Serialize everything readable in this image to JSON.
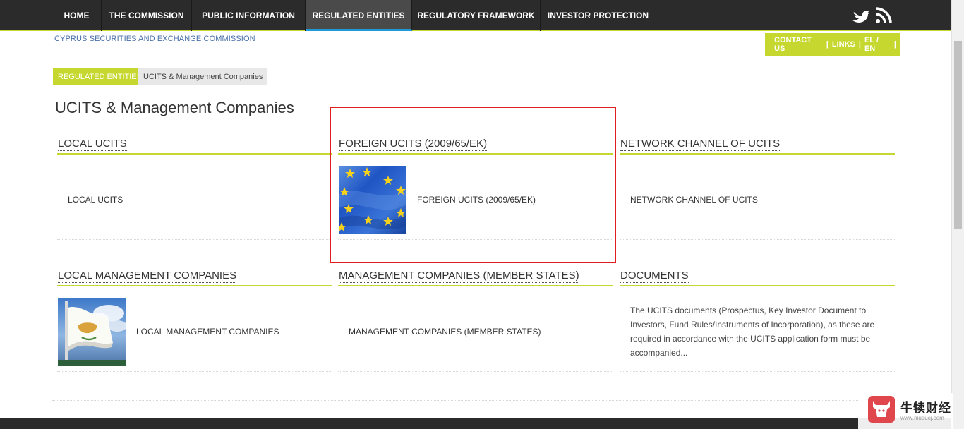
{
  "nav": {
    "items": [
      {
        "label": "HOME"
      },
      {
        "label": "THE COMMISSION"
      },
      {
        "label": "PUBLIC INFORMATION"
      },
      {
        "label": "REGULATED ENTITIES"
      },
      {
        "label": "REGULATORY FRAMEWORK"
      },
      {
        "label": "INVESTOR PROTECTION"
      }
    ],
    "active": "REGULATED ENTITIES",
    "icons": [
      "twitter-icon",
      "rss-icon"
    ]
  },
  "logo_text": "CYPRUS SECURITIES AND EXCHANGE COMMISSION",
  "contact": {
    "contact_us": "CONTACT US",
    "sep": "|",
    "links": "LINKS",
    "lang": "EL / EN"
  },
  "breadcrumb": {
    "parent": "REGULATED ENTITIES",
    "current": "UCITS & Management Companies"
  },
  "page_title": "UCITS & Management Companies",
  "sections": [
    {
      "title": "LOCAL UCITS",
      "link": "LOCAL UCITS"
    },
    {
      "title": "FOREIGN UCITS (2009/65/EK)",
      "link": "FOREIGN UCITS (2009/65/EK)",
      "image": "eu-flag-image"
    },
    {
      "title": "NETWORK CHANNEL OF UCITS",
      "link": "NETWORK CHANNEL OF UCITS"
    },
    {
      "title": "LOCAL MANAGEMENT COMPANIES",
      "link": "LOCAL MANAGEMENT COMPANIES",
      "image": "cyprus-flag-image"
    },
    {
      "title": "MANAGEMENT COMPANIES (MEMBER STATES)",
      "link": "MANAGEMENT COMPANIES (MEMBER STATES)"
    },
    {
      "title": "DOCUMENTS",
      "description": "The UCITS documents (Prospectus, Key Investor Document to Investors, Fund Rules/Instruments of Incorporation), as these are required in accordance with the UCITS application form must be accompanied..."
    }
  ],
  "watermark": {
    "text": "牛犊财经",
    "url": "www.niuducj.com"
  },
  "colors": {
    "accent": "#c6d82f",
    "nav_bg": "#2b2b2b",
    "active_underline": "#1e9bd7",
    "highlight": "#e02020"
  }
}
